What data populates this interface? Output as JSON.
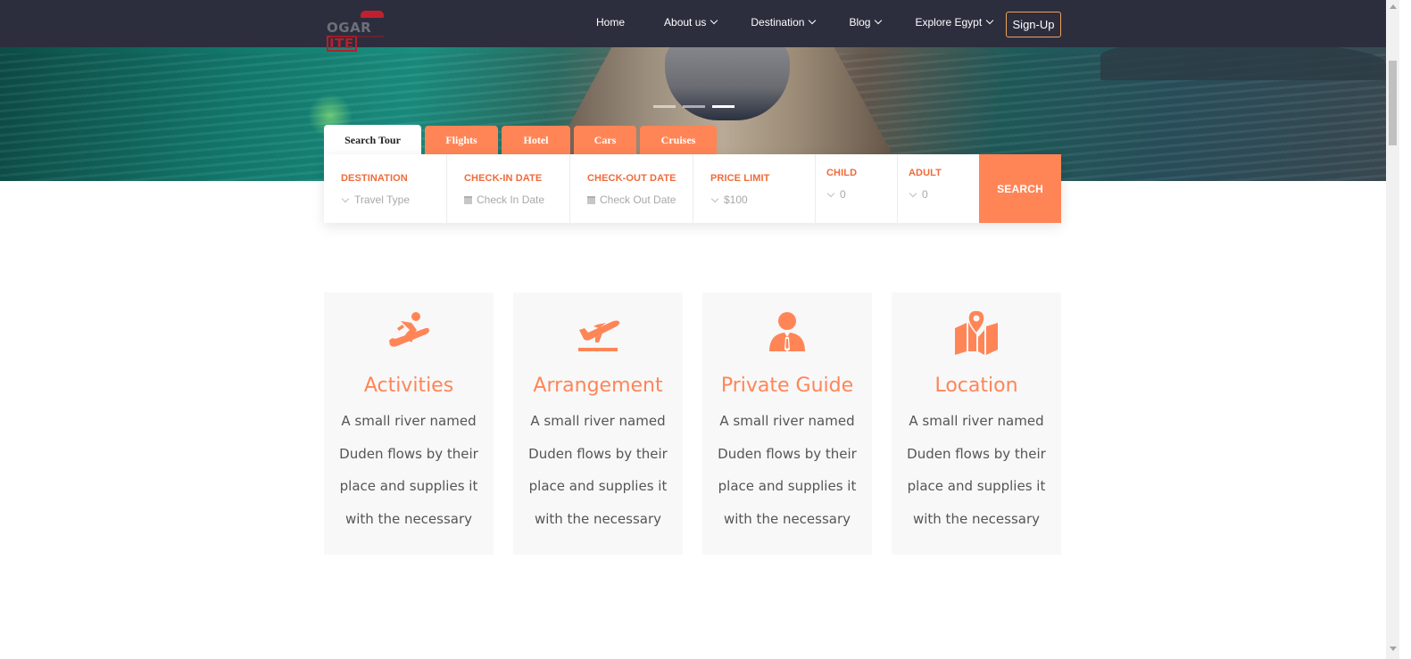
{
  "brand": {
    "logo_text": "OGARITE"
  },
  "nav": {
    "items": [
      {
        "label": "Home",
        "dropdown": false
      },
      {
        "label": "About us",
        "dropdown": true
      },
      {
        "label": "Destination",
        "dropdown": true
      },
      {
        "label": "Blog",
        "dropdown": true
      },
      {
        "label": "Explore Egypt",
        "dropdown": true
      }
    ],
    "signup_label": "Sign-Up"
  },
  "slider": {
    "slide_count": 3,
    "active_slide": 3
  },
  "search": {
    "tabs": [
      {
        "label": "Search Tour",
        "active": true
      },
      {
        "label": "Flights",
        "active": false
      },
      {
        "label": "Hotel",
        "active": false
      },
      {
        "label": "Cars",
        "active": false
      },
      {
        "label": "Cruises",
        "active": false
      }
    ],
    "fields": [
      {
        "label": "DESTINATION",
        "value": "Travel Type",
        "icon": "chevron-down-icon"
      },
      {
        "label": "CHECK-IN DATE",
        "value": "Check In Date",
        "icon": "calendar-icon"
      },
      {
        "label": "CHECK-OUT DATE",
        "value": "Check Out Date",
        "icon": "calendar-icon"
      },
      {
        "label": "PRICE LIMIT",
        "value": "$100",
        "icon": "chevron-down-icon"
      },
      {
        "label": "CHILD",
        "value": "0",
        "icon": "chevron-down-icon"
      },
      {
        "label": "ADULT",
        "value": "0",
        "icon": "chevron-down-icon"
      }
    ],
    "button_label": "SEARCH"
  },
  "services": [
    {
      "title": "Activities",
      "icon": "snowboarder-icon",
      "description": "A small river named Duden flows by their place and supplies it with the necessary"
    },
    {
      "title": "Arrangement",
      "icon": "plane-departure-icon",
      "description": "A small river named Duden flows by their place and supplies it with the necessary"
    },
    {
      "title": "Private Guide",
      "icon": "guide-person-icon",
      "description": "A small river named Duden flows by their place and supplies it with the necessary"
    },
    {
      "title": "Location",
      "icon": "map-location-icon",
      "description": "A small river named Duden flows by their place and supplies it with the necessary"
    }
  ],
  "colors": {
    "accent": "#ff8557",
    "header_bg": "#2c2e3e",
    "label": "#f06a3a",
    "card_bg": "#f8f8f8"
  }
}
